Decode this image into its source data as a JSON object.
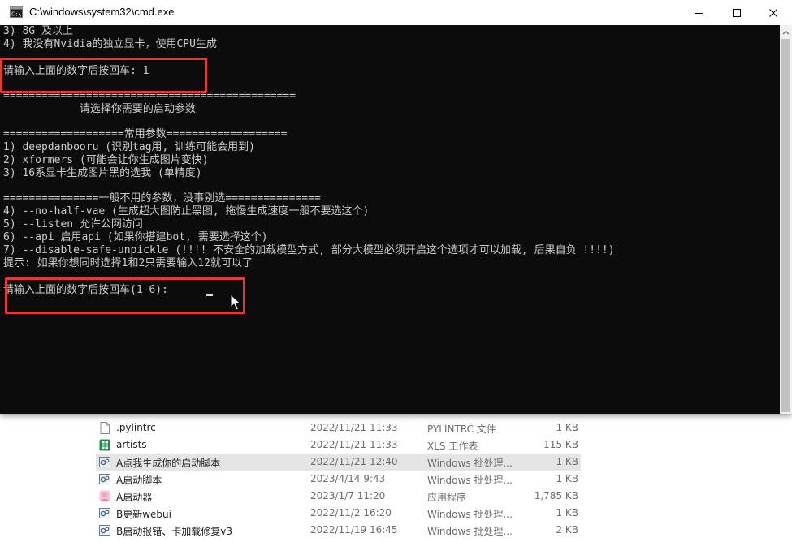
{
  "window": {
    "title": "C:\\windows\\system32\\cmd.exe"
  },
  "console": {
    "lines": [
      "3) 8G 及以上",
      "4) 我没有Nvidia的独立显卡，使用CPU生成",
      "",
      "请输入上面的数字后按回车: 1",
      "",
      "==============================================",
      "            请选择你需要的启动参数",
      "",
      "===================常用参数===================",
      "1) deepdanbooru (识别tag用, 训练可能会用到)",
      "2) xformers (可能会让你生成图片变快)",
      "3) 16系显卡生成图片黑的选我 (单精度)",
      "",
      "===============一般不用的参数，没事别选===============",
      "4) --no-half-vae (生成超大图防止黑图, 拖慢生成速度一般不要选这个)",
      "5) --listen 允许公网访问",
      "6) --api 启用api (如果你搭建bot, 需要选择这个)",
      "7) --disable-safe-unpickle (!!!! 不安全的加载模型方式, 部分大模型必须开启这个选项才可以加载, 后果自负 !!!!)",
      "提示: 如果你想同时选择1和2只需要输入12就可以了",
      "",
      "",
      "请输入上面的数字后按回车(1-6): "
    ]
  },
  "files": [
    {
      "name": ".pylintrc",
      "date": "2022/11/21 11:33",
      "type": "PYLINTRC 文件",
      "size": "1 KB",
      "icon": "document-icon"
    },
    {
      "name": "artists",
      "date": "2022/11/21 11:33",
      "type": "XLS 工作表",
      "size": "115 KB",
      "icon": "spreadsheet-icon"
    },
    {
      "name": "A点我生成你的启动脚本",
      "date": "2022/11/21 12:40",
      "type": "Windows 批处理...",
      "size": "1 KB",
      "icon": "batch-file-icon"
    },
    {
      "name": "A启动脚本",
      "date": "2023/4/14 9:43",
      "type": "Windows 批处理...",
      "size": "1 KB",
      "icon": "batch-file-icon"
    },
    {
      "name": "A启动器",
      "date": "2023/1/7 11:20",
      "type": "应用程序",
      "size": "1,785 KB",
      "icon": "app-icon"
    },
    {
      "name": "B更新webui",
      "date": "2022/11/2 16:20",
      "type": "Windows 批处理...",
      "size": "1 KB",
      "icon": "batch-file-icon"
    },
    {
      "name": "B启动报错、卡加载修复v3",
      "date": "2022/11/19 16:45",
      "type": "Windows 批处理...",
      "size": "2 KB",
      "icon": "batch-file-icon"
    }
  ],
  "colors": {
    "console_bg": "#0c0c0c",
    "console_text": "#cccccc",
    "highlight": "#e53935"
  }
}
